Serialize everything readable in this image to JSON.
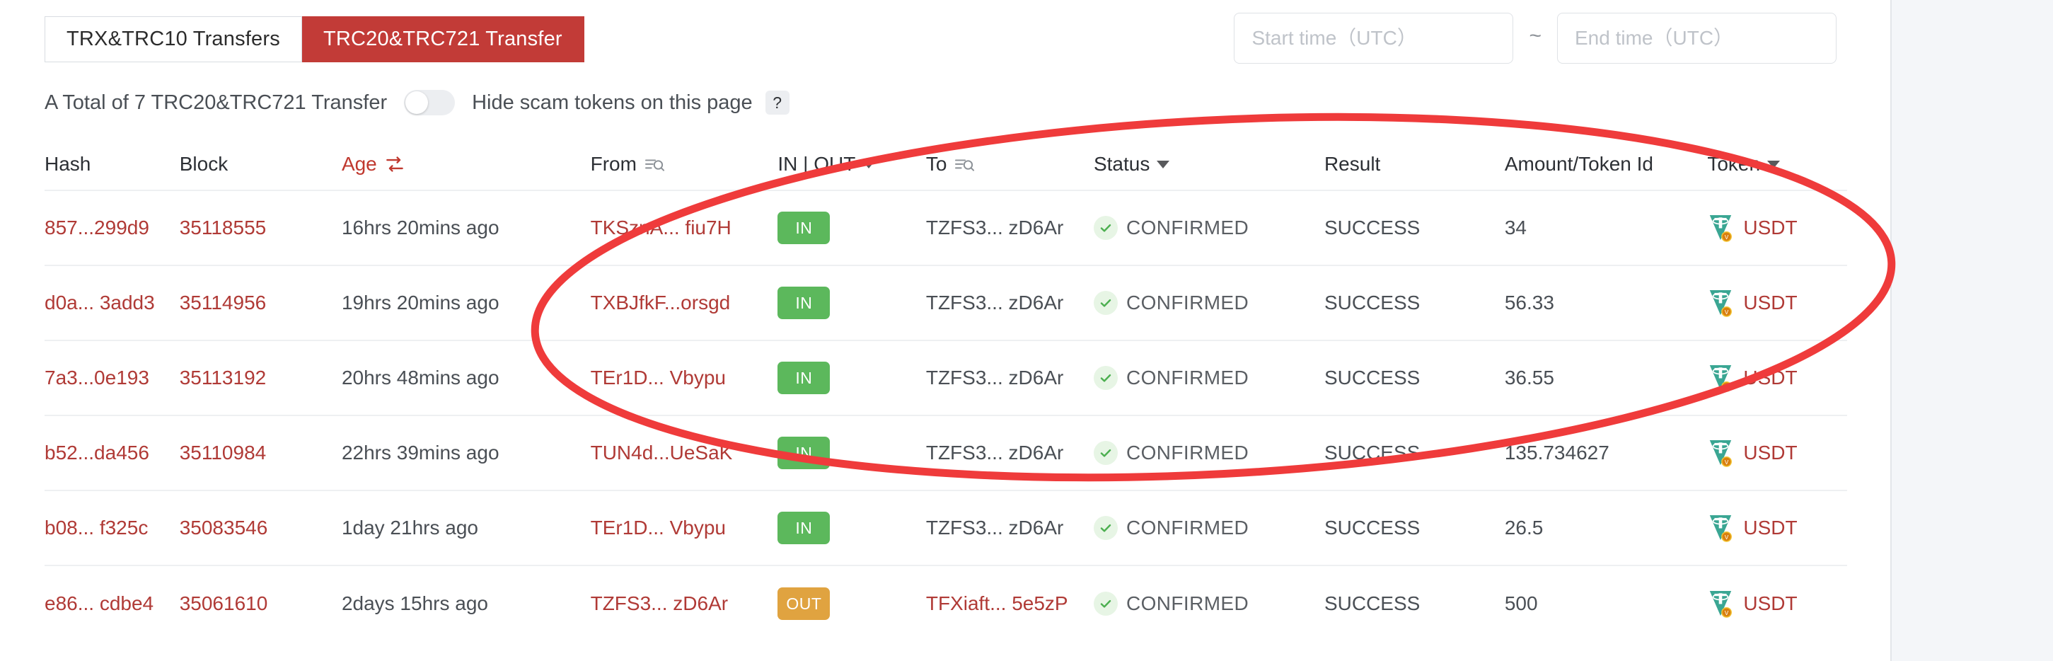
{
  "tabs": [
    {
      "label": "TRX&TRC10 Transfers",
      "active": false
    },
    {
      "label": "TRC20&TRC721 Transfer",
      "active": true
    }
  ],
  "filters": {
    "start_time_placeholder": "Start time（UTC）",
    "end_time_placeholder": "End time（UTC）",
    "start_time_value": "",
    "end_time_value": "",
    "range_separator": "~"
  },
  "summary": {
    "total_text": "A Total of 7 TRC20&TRC721 Transfer",
    "hide_scam_label": "Hide scam tokens on this page",
    "hide_scam_enabled": false,
    "help_glyph": "?"
  },
  "table": {
    "headers": {
      "hash": "Hash",
      "block": "Block",
      "age": "Age",
      "from": "From",
      "inout": "IN | OUT",
      "to": "To",
      "status": "Status",
      "result": "Result",
      "amount": "Amount/Token Id",
      "token": "Token"
    },
    "rows": [
      {
        "hash": "857...299d9",
        "block": "35118555",
        "age": "16hrs 20mins ago",
        "from": "TKSznA... fiu7H",
        "direction": "IN",
        "to": "TZFS3... zD6Ar",
        "status": "CONFIRMED",
        "result": "SUCCESS",
        "amount": "34",
        "token": "USDT"
      },
      {
        "hash": "d0a... 3add3",
        "block": "35114956",
        "age": "19hrs 20mins ago",
        "from": "TXBJfkF...orsgd",
        "direction": "IN",
        "to": "TZFS3... zD6Ar",
        "status": "CONFIRMED",
        "result": "SUCCESS",
        "amount": "56.33",
        "token": "USDT"
      },
      {
        "hash": "7a3...0e193",
        "block": "35113192",
        "age": "20hrs 48mins ago",
        "from": "TEr1D... Vbypu",
        "direction": "IN",
        "to": "TZFS3... zD6Ar",
        "status": "CONFIRMED",
        "result": "SUCCESS",
        "amount": "36.55",
        "token": "USDT"
      },
      {
        "hash": "b52...da456",
        "block": "35110984",
        "age": "22hrs 39mins ago",
        "from": "TUN4d...UeSaK",
        "direction": "IN",
        "to": "TZFS3... zD6Ar",
        "status": "CONFIRMED",
        "result": "SUCCESS",
        "amount": "135.734627",
        "token": "USDT"
      },
      {
        "hash": "b08... f325c",
        "block": "35083546",
        "age": "1day 21hrs ago",
        "from": "TEr1D... Vbypu",
        "direction": "IN",
        "to": "TZFS3... zD6Ar",
        "status": "CONFIRMED",
        "result": "SUCCESS",
        "amount": "26.5",
        "token": "USDT"
      },
      {
        "hash": "e86... cdbe4",
        "block": "35061610",
        "age": "2days 15hrs ago",
        "from": "TZFS3... zD6Ar",
        "direction": "OUT",
        "to": "TFXiaft... 5e5zP",
        "status": "CONFIRMED",
        "result": "SUCCESS",
        "amount": "500",
        "token": "USDT"
      }
    ]
  },
  "colors": {
    "accent_red": "#c23b37",
    "link_red": "#b03a36",
    "in_green": "#5cb85c",
    "out_orange": "#e0a340",
    "annotation_red": "#ef3b3b",
    "panel_bg": "#ffffff",
    "page_bg": "#f4f6f9"
  },
  "annotation": {
    "shape": "ellipse",
    "stroke_color": "#ef3b3b"
  }
}
